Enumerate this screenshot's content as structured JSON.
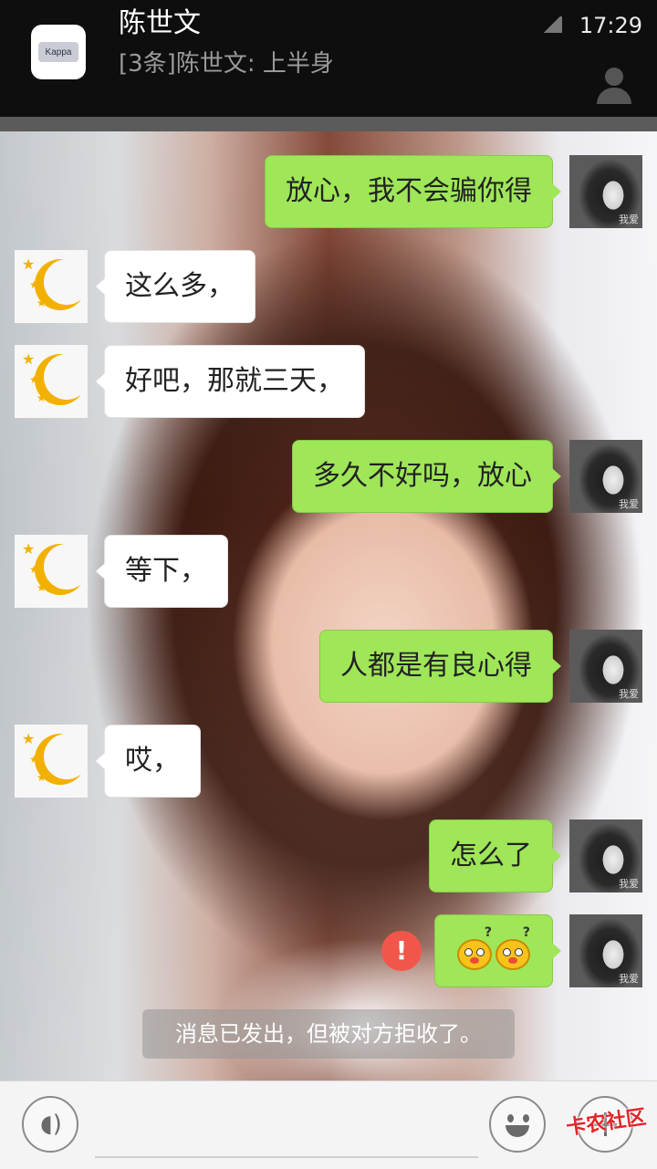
{
  "notification": {
    "title": "陈世文",
    "body": "[3条]陈世文: 上半身",
    "time": "17:29",
    "app_icon": "kappa-logo",
    "app_icon_text": "Kappa"
  },
  "header": {
    "profile_icon": "person-icon"
  },
  "messages": [
    {
      "side": "out",
      "text": "放心，我不会骗你得"
    },
    {
      "side": "in",
      "text": "这么多，"
    },
    {
      "side": "in",
      "text": "好吧，那就三天，"
    },
    {
      "side": "out",
      "text": "多久不好吗，放心"
    },
    {
      "side": "in",
      "text": "等下，"
    },
    {
      "side": "out",
      "text": "人都是有良心得"
    },
    {
      "side": "in",
      "text": "哎，"
    },
    {
      "side": "out",
      "text": "怎么了"
    },
    {
      "side": "out",
      "text": "",
      "emoji": "confused-face-emoji x2",
      "status": "failed"
    }
  ],
  "self_avatar_tag": "我爱",
  "system_notice": "消息已发出，但被对方拒收了。",
  "error_glyph": "!",
  "input": {
    "voice_icon": "voice-icon",
    "emoji_icon": "smiley-icon",
    "plus_icon": "plus-icon",
    "placeholder": ""
  },
  "watermark": "卡农社区",
  "colors": {
    "bubble_out": "#9fe658",
    "bubble_in": "#ffffff",
    "error": "#f2564b"
  }
}
